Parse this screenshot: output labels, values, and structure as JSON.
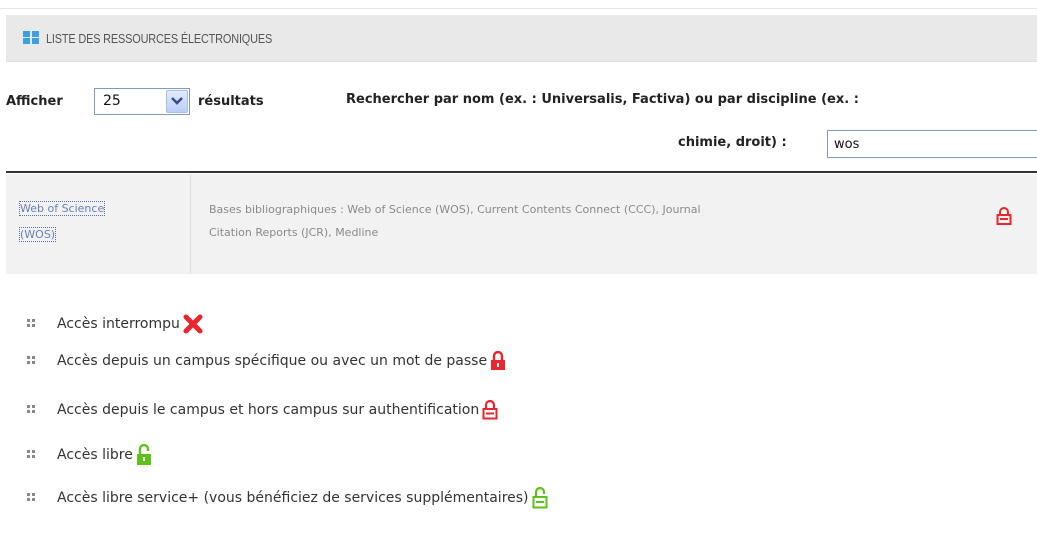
{
  "header": {
    "title": "LISTE DES RESSOURCES ÉLECTRONIQUES",
    "icon": "grid-icon"
  },
  "controls": {
    "show_label": "Afficher",
    "per_page": "25",
    "results_label": "résultats",
    "search_label_line1": "Rechercher par nom (ex. : Universalis, Factiva) ou par discipline (ex. :",
    "search_label_line2": "chimie, droit) :",
    "search_value": "wos"
  },
  "results": [
    {
      "name_line1": "Web of Science",
      "name_line2": "(WOS)",
      "desc_line1": "Bases bibliographiques : Web of Science (WOS), Current Contents Connect (CCC), Journal",
      "desc_line2": "Citation Reports (JCR), Medline",
      "access_icon": "lock-outline-red-icon"
    }
  ],
  "legend": [
    {
      "label": "Accès interrompu",
      "icon": "red-cross-icon"
    },
    {
      "label": "Accès depuis un campus spécifique ou avec un mot de passe",
      "icon": "lock-red-filled-icon"
    },
    {
      "label": "Accès depuis le campus et hors campus sur authentification",
      "icon": "lock-outline-red-icon"
    },
    {
      "label": "Accès libre",
      "icon": "unlock-green-filled-icon"
    },
    {
      "label": "Accès libre service+ (vous bénéficiez de services supplémentaires)",
      "icon": "unlock-outline-green-icon"
    }
  ],
  "colors": {
    "red": "#e8262c",
    "green": "#5cc219",
    "link": "#6a7fb8",
    "header_bg": "#e9e9e9"
  }
}
